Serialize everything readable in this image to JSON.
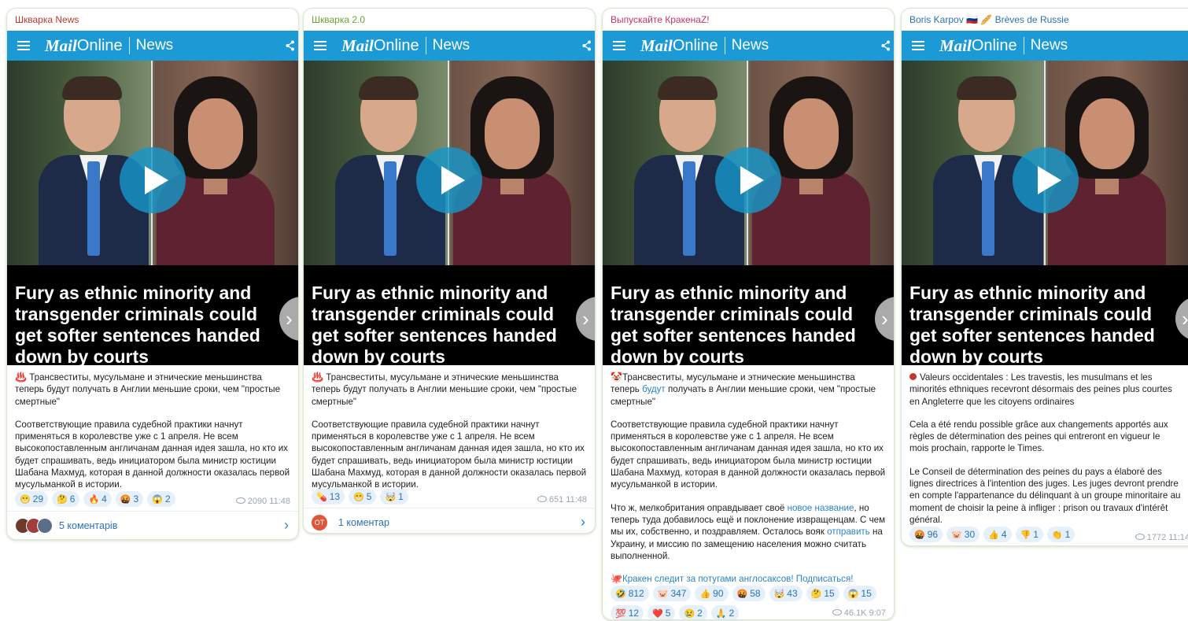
{
  "colors": {
    "dm_blue": "#1b9ad6",
    "reaction_bg": "#e6f0fb",
    "reaction_text": "#2a72b5",
    "link": "#2a85c9"
  },
  "media": {
    "brand": "Mail",
    "brand_suffix": "Online",
    "section": "News",
    "headline": "Fury as ethnic minority and transgender criminals could get softer sentences handed down by courts"
  },
  "posts": [
    {
      "channel": "Шкварка News",
      "lead_emoji": "♨️",
      "lead": "Трансвеститы, мусульмане и этнические меньшинства теперь будут получать в Англии меньшие сроки, чем \"простые смертные\"",
      "body": "Соответствующие правила судебной практики начнут применяться в королевстве уже с 1 апреля. Не всем высокопоставленным англичанам данная идея зашла, но кто их будет спрашивать, ведь инициатором была министр юстиции Шабана Махмуд, которая в данной должности оказалась первой мусульманкой в истории.",
      "reactions": [
        {
          "emoji": "😁",
          "count": "29"
        },
        {
          "emoji": "🤔",
          "count": "6"
        },
        {
          "emoji": "🔥",
          "count": "4"
        },
        {
          "emoji": "🤬",
          "count": "3"
        },
        {
          "emoji": "😱",
          "count": "2"
        }
      ],
      "views": "2090",
      "time": "11:48",
      "comments": "5 коментарів"
    },
    {
      "channel": "Шкварка 2.0",
      "lead_emoji": "♨️",
      "lead": "Трансвеститы, мусульмане и этнические меньшинства теперь будут получать в Англии меньшие сроки, чем \"простые смертные\"",
      "body": "Соответствующие правила судебной практики начнут применяться в королевстве уже с 1 апреля. Не всем высокопоставленным англичанам данная идея зашла, но кто их будет спрашивать, ведь инициатором была министр юстиции Шабана Махмуд, которая в данной должности оказалась первой мусульманкой в истории.",
      "reactions": [
        {
          "emoji": "💊",
          "count": "13"
        },
        {
          "emoji": "😁",
          "count": "5"
        },
        {
          "emoji": "🤯",
          "count": "1"
        }
      ],
      "views": "651",
      "time": "11:48",
      "comment_avatar": "ОТ",
      "comments": "1 коментар"
    },
    {
      "channel": "Выпускайте КракенаZ!",
      "lead_emoji": "🤡",
      "lead_a": "Трансвеститы, мусульмане и этнические меньшинства теперь ",
      "lead_link": "будут",
      "lead_b": " получать в Англии меньшие сроки, чем \"простые смертные\"",
      "body": "Соответствующие правила судебной практики начнут применяться в королевстве уже с 1 апреля. Не всем высокопоставленным англичанам данная идея зашла, но кто их будет спрашивать, ведь инициатором была министр юстиции Шабана Махмуд, которая в данной должности оказалась первой мусульманкой в истории.",
      "extra_a": "Что ж, мелкобритания оправдывает своё ",
      "extra_link1": "новое название",
      "extra_b": ", но теперь туда добавилось ещё и поклонение извращенцам. С чем мы их, собственно, и поздравляем. Осталось вояк ",
      "extra_link2": "отправить",
      "extra_c": " на Украину, и миссию по замещению населения можно считать выполненной.",
      "promo_emoji": "🐙",
      "promo": "Кракен следит за потугами англосаксов! Подписаться!",
      "reactions": [
        {
          "emoji": "🤣",
          "count": "812"
        },
        {
          "emoji": "🐷",
          "count": "347"
        },
        {
          "emoji": "👍",
          "count": "90"
        },
        {
          "emoji": "🤬",
          "count": "58"
        },
        {
          "emoji": "🤯",
          "count": "43"
        },
        {
          "emoji": "🤔",
          "count": "15"
        },
        {
          "emoji": "😱",
          "count": "15"
        },
        {
          "emoji": "💯",
          "count": "12"
        },
        {
          "emoji": "❤️",
          "count": "5"
        },
        {
          "emoji": "😢",
          "count": "2"
        },
        {
          "emoji": "🙏",
          "count": "2"
        }
      ],
      "views": "46.1K",
      "time": "9:07"
    },
    {
      "channel": "Boris Karpov 🇷🇺 🥖 Brèves de Russie",
      "lead": "Valeurs occidentales : Les travestis, les musulmans et les minorités ethniques recevront désormais des peines plus courtes en Angleterre que les citoyens ordinaires",
      "body1": "Cela a été rendu possible grâce aux changements apportés aux règles de détermination des peines qui entreront en vigueur le mois prochain, rapporte le Times.",
      "body2": "Le Conseil de détermination des peines du pays a élaboré des lignes directrices à l'intention des juges. Les juges devront prendre en compte l'appartenance du délinquant à un groupe minoritaire au moment de choisir la peine à infliger : prison ou travaux d'intérêt général.",
      "reactions": [
        {
          "emoji": "🤬",
          "count": "96"
        },
        {
          "emoji": "🐷",
          "count": "30"
        },
        {
          "emoji": "👍",
          "count": "4"
        },
        {
          "emoji": "👎",
          "count": "1"
        },
        {
          "emoji": "👏",
          "count": "1"
        }
      ],
      "views": "1772",
      "time": "11:14"
    }
  ]
}
